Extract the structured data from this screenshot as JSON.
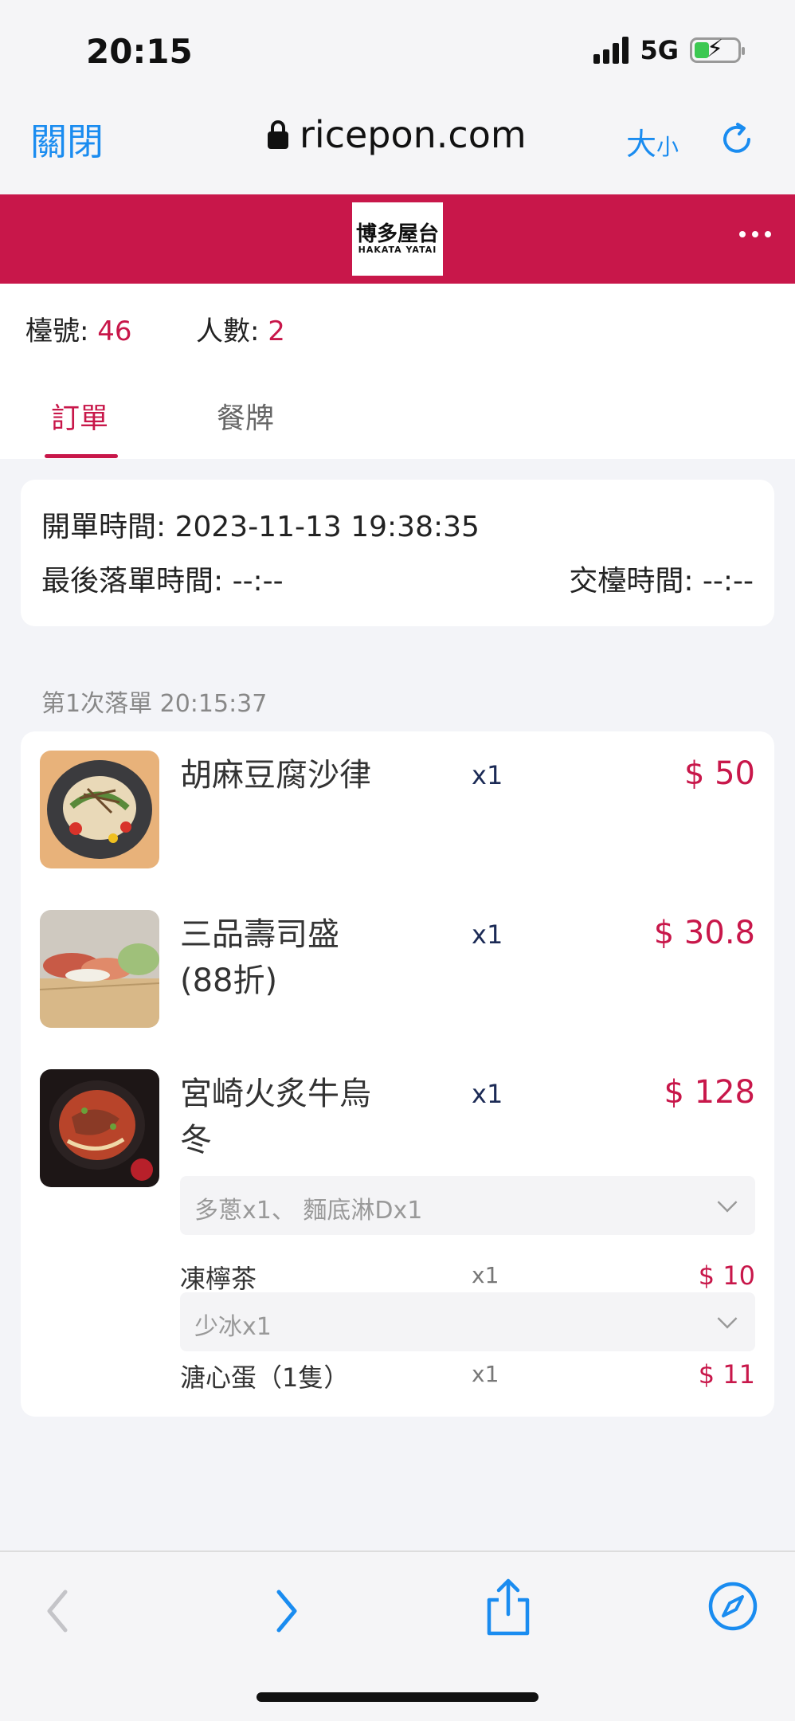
{
  "status": {
    "time": "20:15",
    "network": "5G"
  },
  "browser": {
    "close": "關閉",
    "url": "ricepon.com",
    "size_main": "大",
    "size_small": "小"
  },
  "brand": {
    "logo_main": "博多屋台",
    "logo_sub": "HAKATA YATAI"
  },
  "info": {
    "table_label": "檯號:",
    "table_value": "46",
    "people_label": "人數:",
    "people_value": "2",
    "tabs": [
      {
        "label": "訂單"
      },
      {
        "label": "餐牌"
      }
    ]
  },
  "order": {
    "open_time": "開單時間: 2023-11-13 19:38:35",
    "last_order": "最後落單時間: --:--",
    "checkout": "交檯時間: --:--"
  },
  "batch": {
    "label": "第1次落單 20:15:37"
  },
  "items": [
    {
      "name": "胡麻豆腐沙律",
      "qty": "x1",
      "price": "$ 50",
      "image": "sesame-tofu-salad"
    },
    {
      "name": "三品壽司盛(88折)",
      "qty": "x1",
      "price": "$ 30.8",
      "image": "sushi-platter"
    },
    {
      "name": "宮崎火炙牛烏冬",
      "qty": "x1",
      "price": "$ 128",
      "image": "beef-udon"
    }
  ],
  "udon_options": "多蔥x1、 麵底淋Dx1",
  "addons": [
    {
      "name": "凍檸茶",
      "qty": "x1",
      "price": "$ 10",
      "options": "少冰x1"
    },
    {
      "name": "溏心蛋（1隻）",
      "qty": "x1",
      "price": "$ 11"
    }
  ],
  "colors": {
    "brand": "#c8174a",
    "link": "#1a8cf0",
    "qty": "#1b2a55"
  },
  "icons": [
    "lock-icon",
    "reload-icon",
    "more-icon",
    "chevron-down-icon",
    "back-icon",
    "forward-icon",
    "share-icon",
    "compass-icon"
  ]
}
